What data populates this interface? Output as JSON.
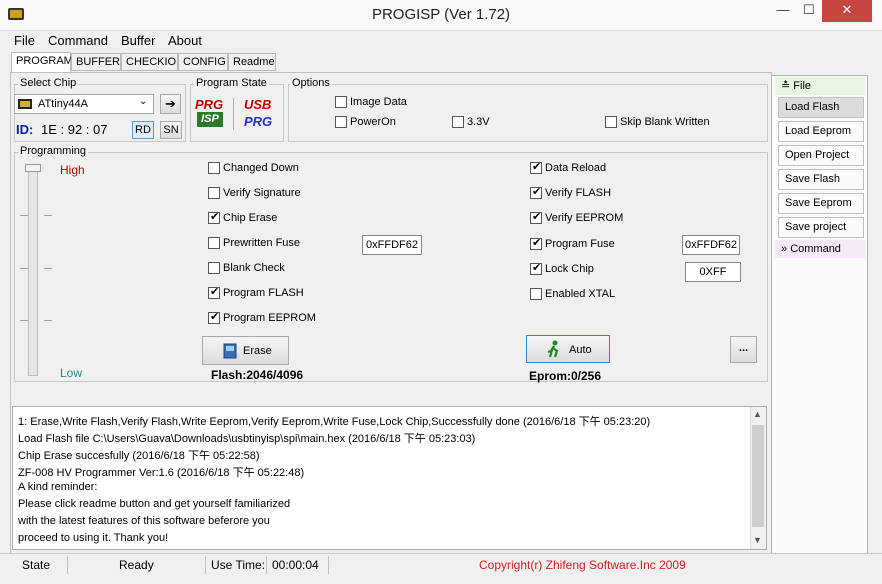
{
  "window": {
    "title": "PROGISP (Ver 1.72)",
    "min": "—",
    "max": "☐",
    "close": "✕"
  },
  "menu": [
    "File",
    "Command",
    "Buffer",
    "About"
  ],
  "tabs": [
    "PROGRAM",
    "BUFFER",
    "CHECKIO",
    "CONFIG",
    "Readme"
  ],
  "select_chip": {
    "label": "Select Chip",
    "value": "ATtiny44A",
    "id_label": "ID:",
    "id_value": "1E : 92 : 07",
    "rd": "RD",
    "sn": "SN"
  },
  "program_state": {
    "label": "Program State",
    "prg_isp": [
      "PRG",
      "ISP"
    ],
    "usb_prg": [
      "USB",
      "PRG"
    ]
  },
  "options": {
    "label": "Options",
    "image_data": "Image Data",
    "poweron": "PowerOn",
    "v33": "3.3V",
    "skip_blank": "Skip Blank Written"
  },
  "programming": {
    "label": "Programming",
    "high": "High",
    "low": "Low",
    "left_checks": [
      {
        "label": "Changed Down",
        "checked": false
      },
      {
        "label": "Verify Signature",
        "checked": false
      },
      {
        "label": "Chip Erase",
        "checked": true
      },
      {
        "label": "Prewritten Fuse",
        "checked": false
      },
      {
        "label": "Blank Check",
        "checked": false
      },
      {
        "label": "Program FLASH",
        "checked": true
      },
      {
        "label": "Program EEPROM",
        "checked": true
      }
    ],
    "right_checks": [
      {
        "label": "Data Reload",
        "checked": true
      },
      {
        "label": "Verify FLASH",
        "checked": true
      },
      {
        "label": "Verify EEPROM",
        "checked": true
      },
      {
        "label": "Program Fuse",
        "checked": true
      },
      {
        "label": "Lock Chip",
        "checked": true
      },
      {
        "label": "Enabled XTAL",
        "checked": false
      }
    ],
    "prewritten_fuse_value": "0xFFDF62",
    "program_fuse_value": "0xFFDF62",
    "lock_value": "0XFF",
    "erase_button": "Erase",
    "auto_button": "Auto",
    "more_button": "...",
    "flash_info": "Flash:2046/4096",
    "eprom_info": "Eprom:0/256"
  },
  "sidebar": {
    "file_head": "File",
    "buttons": [
      "Load Flash",
      "Load Eeprom",
      "Open Project",
      "Save Flash",
      "Save Eeprom",
      "Save project"
    ],
    "command_head": "Command"
  },
  "log": [
    "1: Erase,Write Flash,Verify Flash,Write Eeprom,Verify Eeprom,Write Fuse,Lock Chip,Successfully done (2016/6/18 下午 05:23:20)",
    "Load Flash file C:\\Users\\Guava\\Downloads\\usbtinyisp\\spi\\main.hex (2016/6/18 下午 05:23:03)",
    "Chip Erase succesfully (2016/6/18 下午 05:22:58)",
    "ZF-008 HV Programmer Ver:1.6 (2016/6/18 下午 05:22:48)",
    "A kind reminder:",
    "Please click readme button and get yourself familiarized",
    "with the latest features of this software beferore you",
    "proceed to using it. Thank you!"
  ],
  "status": {
    "state_label": "State",
    "state_value": "Ready",
    "time_label": "Use Time:",
    "time_value": "00:00:04",
    "copyright": "Copyright(r) Zhifeng Software.Inc 2009"
  },
  "colors": {
    "high": "#c00000",
    "low": "#2a8a8a",
    "copyright": "#d02020",
    "prg": "#c00000",
    "isp_bg": "#2a7a2a",
    "usb": "#c00000",
    "usb_prg": "#2030c0",
    "id_label": "#0020a0"
  },
  "icons": {
    "window": "chip-icon",
    "arrow": "arrow-right-icon",
    "erase": "eraser-icon",
    "auto": "runner-icon"
  }
}
